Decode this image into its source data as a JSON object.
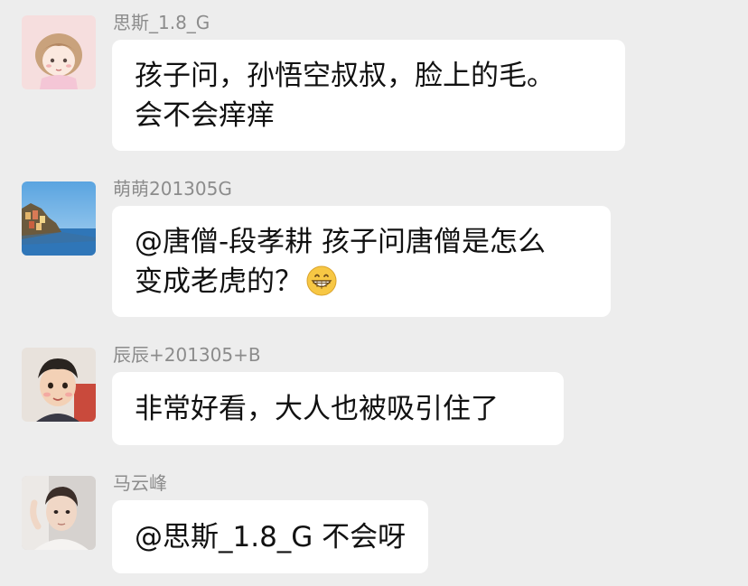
{
  "messages": [
    {
      "sender": "思斯_1.8_G",
      "avatar": "cartoon-girl-avatar",
      "lines": [
        "孩子问，孙悟空叔叔，脸上的毛。",
        "会不会痒痒"
      ]
    },
    {
      "sender": "萌萌201305G",
      "avatar": "coastal-village-avatar",
      "lines": [
        "@唐僧-段孝耕 孩子问唐僧是怎么",
        "变成老虎的？"
      ],
      "emoji": "grinning-face-emoji"
    },
    {
      "sender": "辰辰+201305+B",
      "avatar": "child-photo-avatar",
      "lines": [
        "非常好看，大人也被吸引住了"
      ]
    },
    {
      "sender": "马云峰",
      "avatar": "man-portrait-avatar",
      "lines": [
        "@思斯_1.8_G 不会呀"
      ]
    }
  ],
  "colors": {
    "background": "#ededed",
    "bubble": "#ffffff",
    "text": "#111111",
    "sender": "#8c8c8c"
  }
}
